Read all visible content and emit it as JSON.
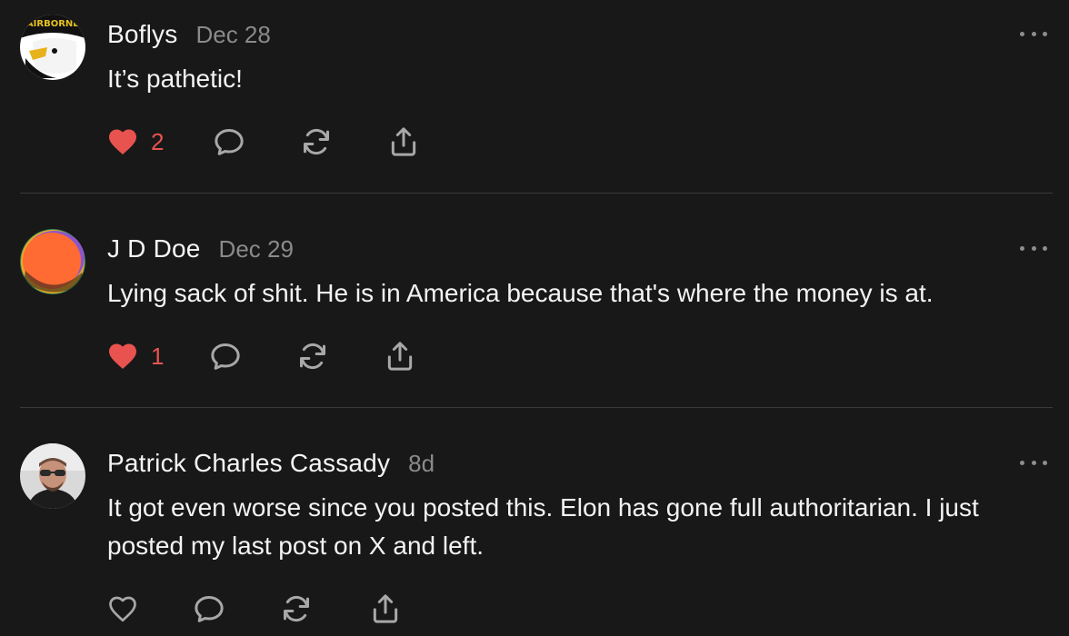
{
  "comments": [
    {
      "author": "Boflys",
      "date": "Dec 28",
      "text": "It’s pathetic!",
      "likes": "2",
      "liked": true,
      "avatar_badge_text": "AIRBORNE"
    },
    {
      "author": "J D Doe",
      "date": "Dec 29",
      "text": "Lying sack of shit. He is in America because that's where the money is at.",
      "likes": "1",
      "liked": true
    },
    {
      "author": "Patrick Charles Cassady",
      "date": "8d",
      "text": "It got even worse since you posted this. Elon has gone full authoritarian. I just posted my last post on X and left.",
      "likes": "",
      "liked": false
    }
  ],
  "icons": {
    "like": "heart-icon",
    "reply": "speech-bubble-icon",
    "restack": "refresh-arrows-icon",
    "share": "share-upload-icon",
    "more": "ellipsis-icon"
  },
  "colors": {
    "background": "#181818",
    "liked_heart": "#e8534f",
    "muted_text": "#8a8a8a",
    "icon_gray": "#a8a8a8",
    "divider": "#3a3a3a"
  }
}
